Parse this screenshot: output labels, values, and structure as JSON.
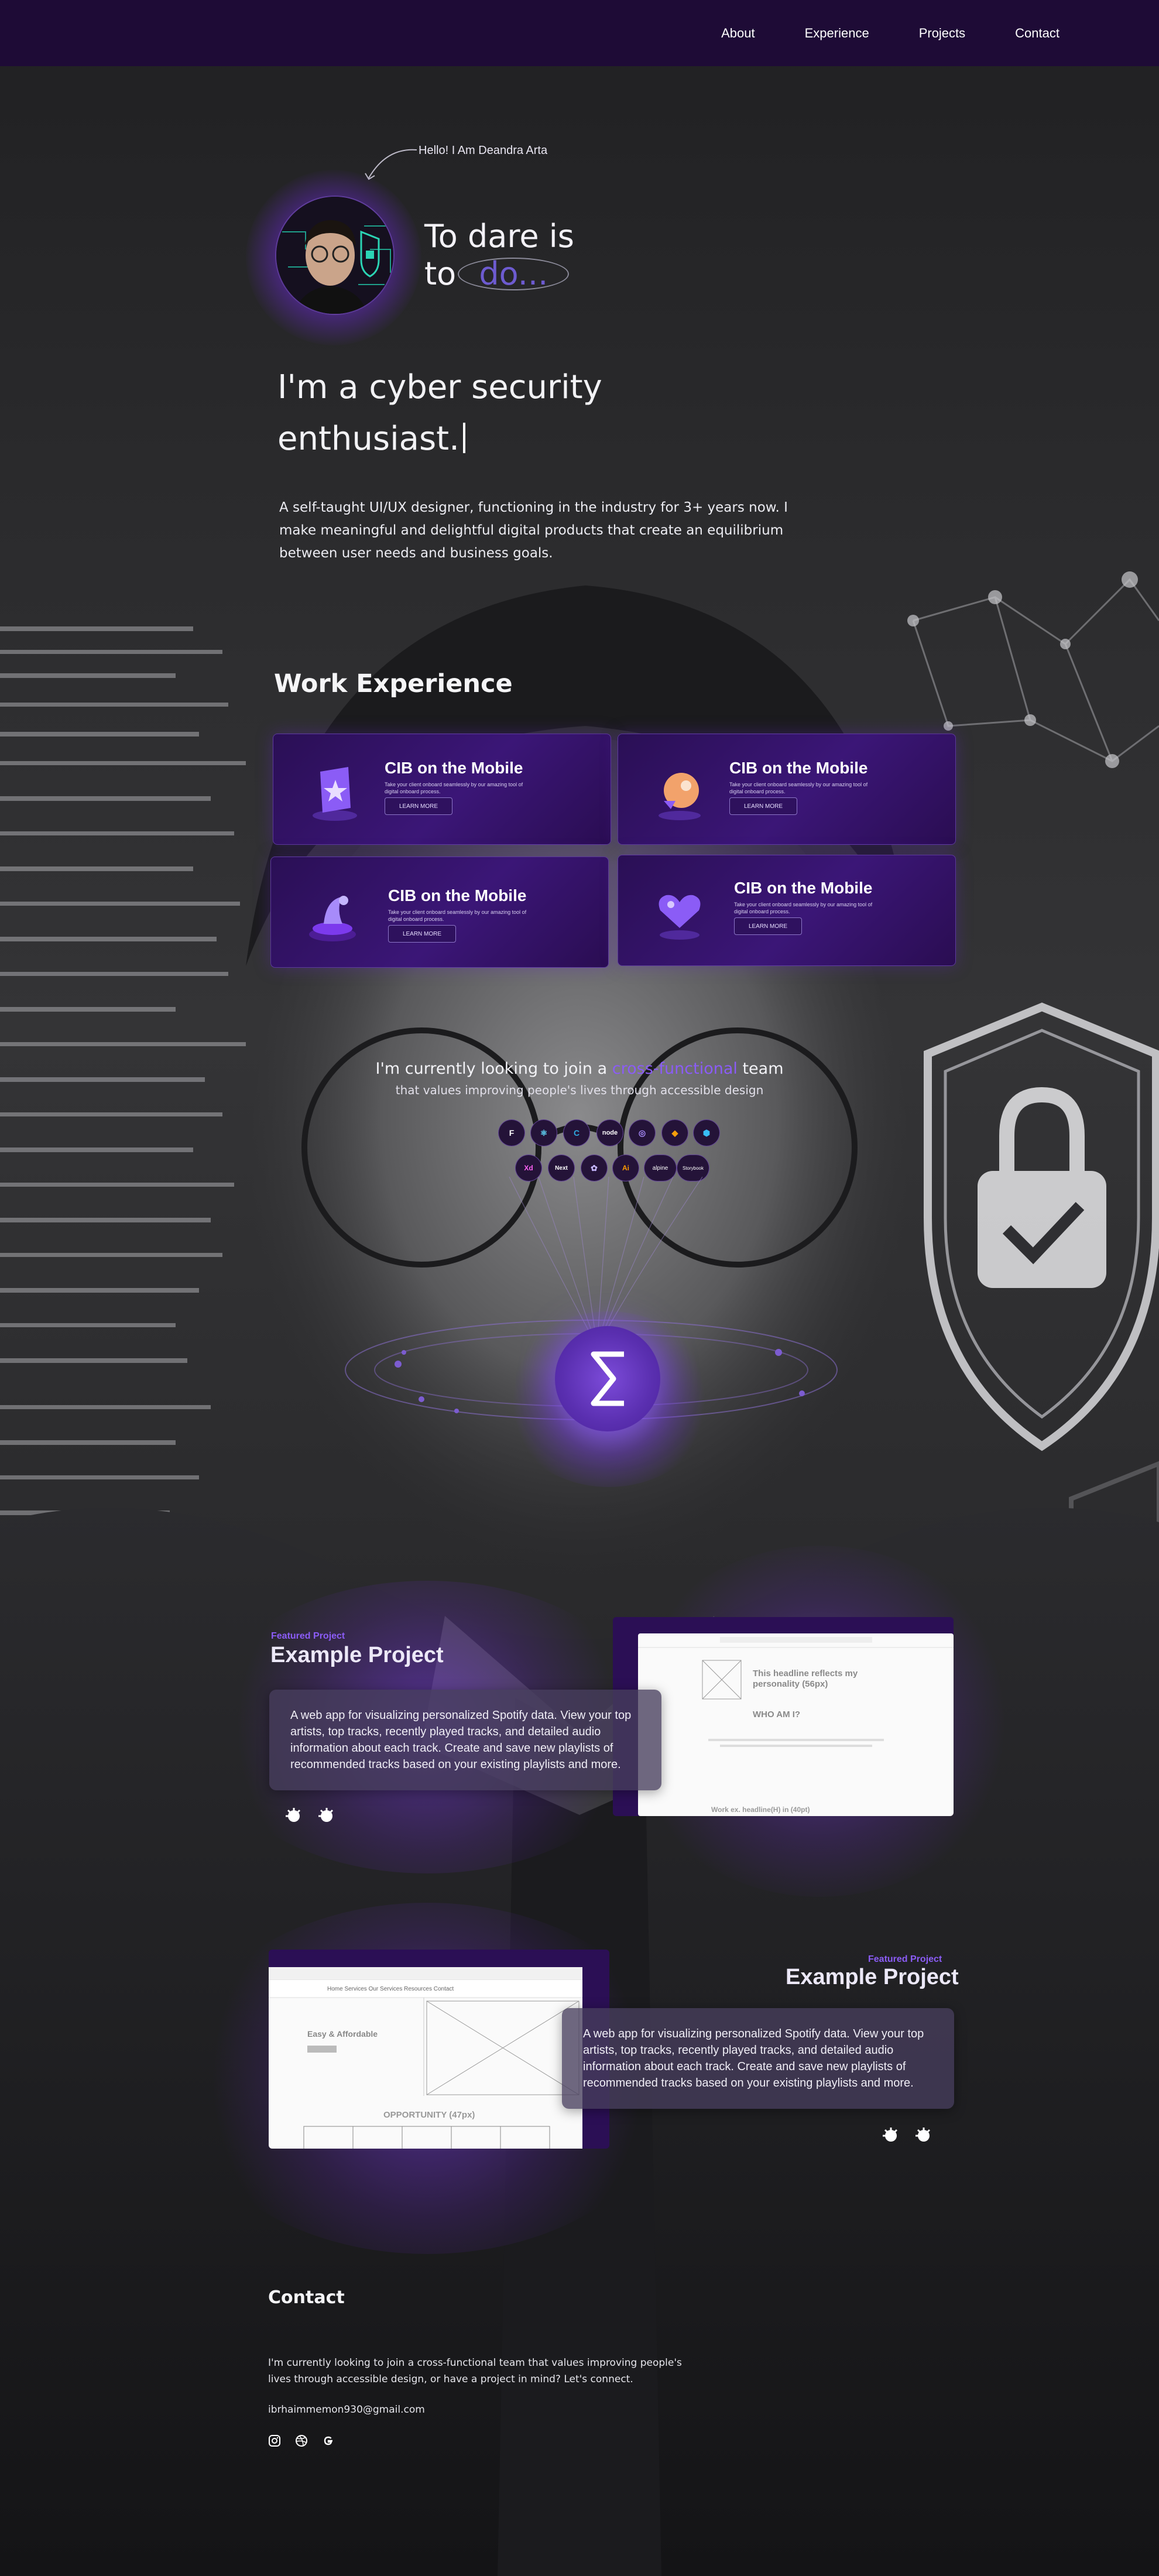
{
  "nav": {
    "items": [
      "About",
      "Experience",
      "Projects",
      "Contact"
    ]
  },
  "hero": {
    "greeting": "Hello! I Am Deandra Arta",
    "tagline_line1": "To dare is",
    "tagline_to": "to",
    "tagline_do": "do...",
    "headline": "I'm a cyber security enthusiast.",
    "intro": "A self-taught UI/UX designer, functioning in the industry for 3+ years now. I make meaningful and delightful digital products that create an equilibrium between user needs and business goals."
  },
  "experience": {
    "title": "Work Experience",
    "cards": [
      {
        "title": "CIB on the Mobile",
        "text": "Take your client onboard seamlessly by our amazing tool of digital onboard process.",
        "button": "LEARN MORE"
      },
      {
        "title": "CIB on the Mobile",
        "text": "Take your client onboard seamlessly by our amazing tool of digital onboard process.",
        "button": "LEARN MORE"
      },
      {
        "title": "CIB on the Mobile",
        "text": "Take your client onboard seamlessly by our amazing tool of digital onboard process.",
        "button": "LEARN MORE"
      },
      {
        "title": "CIB on the Mobile",
        "text": "Take your client onboard seamlessly by our amazing tool of digital onboard process.",
        "button": "LEARN MORE"
      }
    ]
  },
  "skills": {
    "heading_pre": "I'm currently looking to join a",
    "heading_accent": "cross-functional",
    "heading_post": "team",
    "subheading": "that values improving people's lives through accessible design",
    "row1": [
      "F",
      "⚛",
      "C",
      "node",
      "◎",
      "◆",
      "⬢"
    ],
    "row2": [
      "Xd",
      "Next",
      "✿",
      "Ai",
      "alpine",
      "Storybook"
    ],
    "accent_color": "#8b5cf6"
  },
  "projects": [
    {
      "label": "Featured Project",
      "title": "Example Project",
      "description": "A web app for visualizing personalized Spotify data. View your top artists, top tracks, recently played tracks, and detailed audio information about each track. Create and save new playlists of recommended tracks based on your existing playlists and more.",
      "mock_heading": "This headline reflects my personality (56px)",
      "mock_section": "WHO AM I?",
      "mock_footer": "Work ex. headline(H) in (40pt)"
    },
    {
      "label": "Featured Project",
      "title": "Example Project",
      "description": "A web app for visualizing personalized Spotify data. View your top artists, top tracks, recently played tracks, and detailed audio information about each track. Create and save new playlists of recommended tracks based on your existing playlists and more.",
      "mock_heading": "Easy & Affordable",
      "mock_section": "OPPORTUNITY (47px)",
      "mock_nav": "Home   Services   Our Services   Resources   Contact"
    }
  ],
  "contact": {
    "title": "Contact",
    "text": "I'm currently looking to join a cross-functional team that values improving people's lives through accessible design, or have a project in mind? Let's connect.",
    "email": "ibrhaimmemon930@gmail.com"
  },
  "colors": {
    "nav_bg": "#1e0b36",
    "card_bg": "#3b1677",
    "accent": "#8b5cf6"
  },
  "icons": [
    "instagram-icon",
    "dribbble-icon",
    "google-icon",
    "github-icon",
    "external-link-icon"
  ]
}
